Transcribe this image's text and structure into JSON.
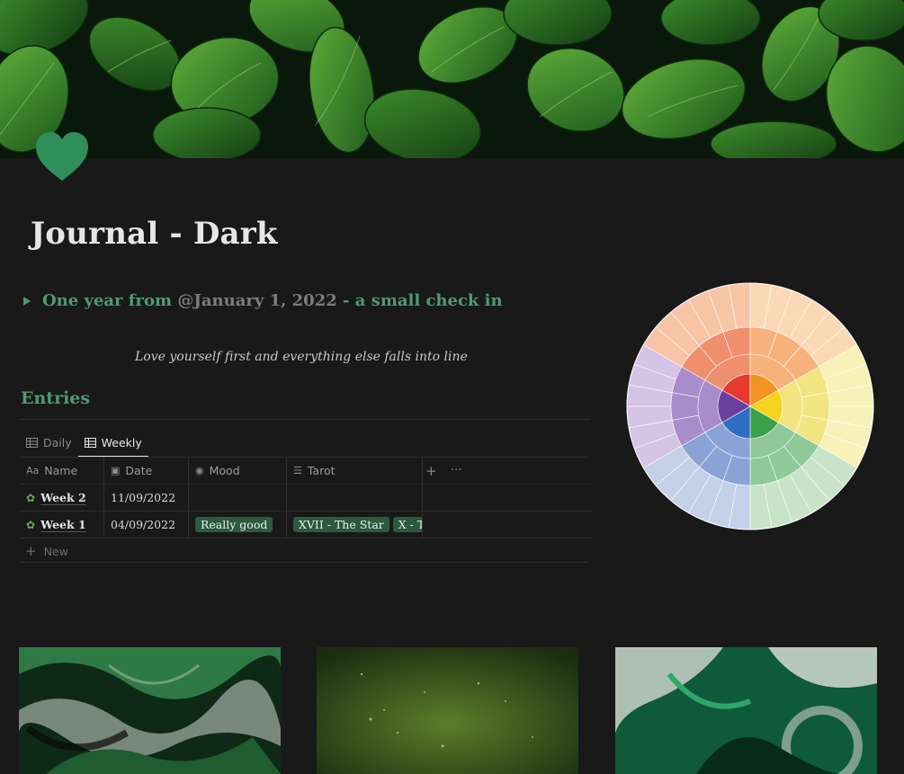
{
  "page": {
    "title": "Journal - Dark",
    "icon": "heart-icon",
    "cover": "leaves-cover"
  },
  "toggle": {
    "prefix": "One year from ",
    "date_mention": "@January 1, 2022",
    "suffix": " - a small check in"
  },
  "quote": "Love yourself first and everything else falls into line",
  "entries": {
    "heading": "Entries",
    "tabs": [
      {
        "label": "Daily",
        "icon": "table-icon"
      },
      {
        "label": "Weekly",
        "icon": "table-icon"
      }
    ],
    "columns": [
      {
        "label": "Name",
        "icon": "text-icon",
        "icon_glyph": "Aa"
      },
      {
        "label": "Date",
        "icon": "calendar-icon",
        "icon_glyph": "▣"
      },
      {
        "label": "Mood",
        "icon": "select-icon",
        "icon_glyph": "◉"
      },
      {
        "label": "Tarot",
        "icon": "list-icon",
        "icon_glyph": "☰"
      }
    ],
    "rows": [
      {
        "name": "Week 2",
        "date": "11/09/2022",
        "mood": "",
        "tarot": []
      },
      {
        "name": "Week 1",
        "date": "04/09/2022",
        "mood": "Really good",
        "tarot": [
          "XVII - The Star",
          "X - The"
        ]
      }
    ],
    "new_label": "New",
    "add_icon": "+",
    "more_icon": "···"
  },
  "colors": {
    "background": "#191919",
    "accent_green": "#4f9b6e",
    "tag_green": "#2b5a3e"
  },
  "gallery": [
    "green-marble-image",
    "green-texture-image",
    "green-swirl-image"
  ]
}
